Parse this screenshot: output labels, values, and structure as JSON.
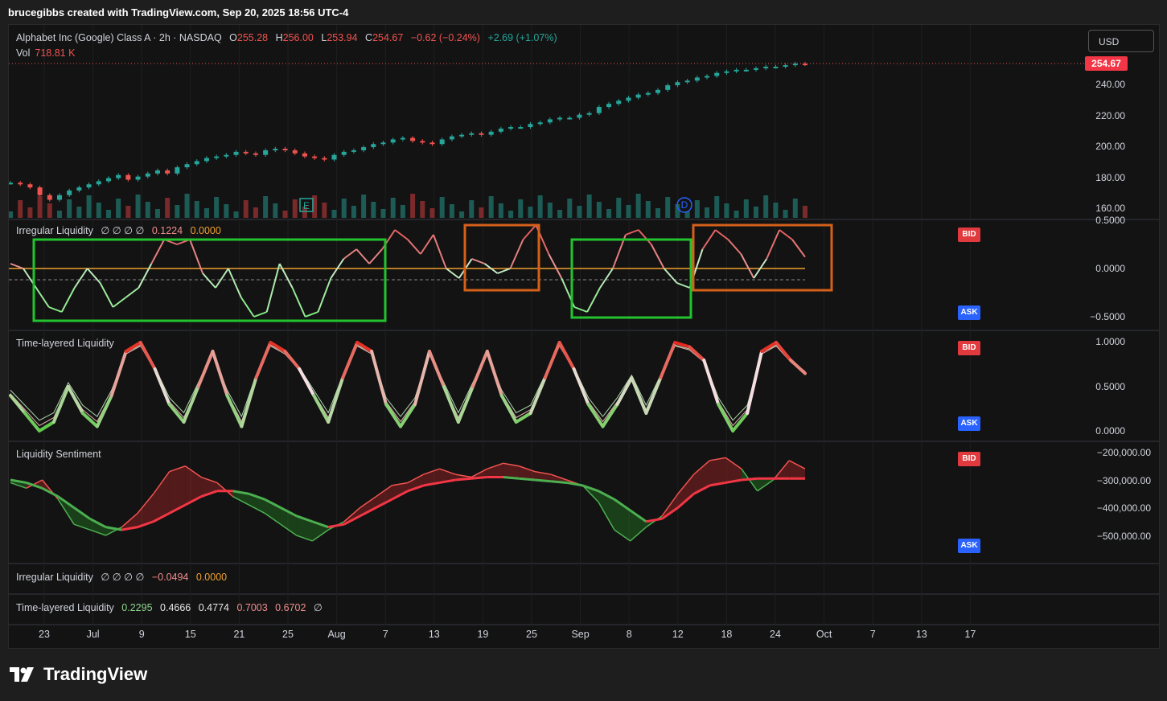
{
  "header": {
    "text": "brucegibbs created with TradingView.com, Sep 20, 2025 18:56 UTC-4"
  },
  "main_pane": {
    "symbol": "Alphabet Inc (Google) Class A · 2h · NASDAQ",
    "o_label": "O",
    "o_value": "255.28",
    "h_label": "H",
    "h_value": "256.00",
    "l_label": "L",
    "l_value": "253.94",
    "c_label": "C",
    "c_value": "254.67",
    "change": "−0.62 (−0.24%)",
    "change2": "+2.69 (+1.07%)",
    "vol_label": "Vol",
    "vol_value": "718.81 K",
    "currency": "USD",
    "last_price": "254.67",
    "y_ticks": [
      "240.00",
      "220.00",
      "200.00",
      "180.00",
      "160.00"
    ],
    "markers": {
      "earnings": "E",
      "dividend": "D"
    }
  },
  "irregular_pane": {
    "title": "Irregular Liquidity",
    "params": "∅ ∅ ∅ ∅",
    "v1": "0.1224",
    "v2": "0.0000",
    "y_ticks": [
      "0.5000",
      "0.0000",
      "−0.5000"
    ],
    "bid": "BID",
    "ask": "ASK"
  },
  "timelayered_pane": {
    "title": "Time-layered Liquidity",
    "y_ticks": [
      "1.0000",
      "0.5000",
      "0.0000"
    ],
    "bid": "BID",
    "ask": "ASK"
  },
  "sentiment_pane": {
    "title": "Liquidity Sentiment",
    "y_ticks": [
      "−200,000.00",
      "−300,000.00",
      "−400,000.00",
      "−500,000.00"
    ],
    "bid": "BID",
    "ask": "ASK"
  },
  "collapsed1": {
    "title": "Irregular Liquidity",
    "params": "∅ ∅ ∅ ∅",
    "v1": "−0.0494",
    "v2": "0.0000"
  },
  "collapsed2": {
    "title": "Time-layered Liquidity",
    "v1": "0.2295",
    "v2": "0.4666",
    "v3": "0.4774",
    "v4": "0.7003",
    "v5": "0.6702",
    "v6": "∅"
  },
  "x_ticks": [
    "23",
    "Jul",
    "9",
    "15",
    "21",
    "25",
    "Aug",
    "7",
    "13",
    "19",
    "25",
    "Sep",
    "8",
    "12",
    "18",
    "24",
    "Oct",
    "7",
    "13",
    "17"
  ],
  "logo": {
    "text": "TradingView"
  },
  "colors": {
    "up": "#26a69a",
    "down": "#ef5350",
    "green_box": "#22c32e",
    "orange_box": "#d4601a",
    "bid": "#e03a3e",
    "ask": "#2962ff"
  },
  "series": {
    "close": [
      178,
      177,
      175,
      170,
      167,
      170,
      173,
      175,
      177,
      179,
      181,
      183,
      180,
      182,
      184,
      186,
      184,
      188,
      190,
      192,
      194,
      195,
      196,
      198,
      197,
      196,
      199,
      200,
      199,
      197,
      195,
      194,
      193,
      196,
      198,
      199,
      201,
      203,
      204,
      206,
      207,
      205,
      204,
      203,
      206,
      208,
      209,
      210,
      209,
      211,
      213,
      214,
      214,
      216,
      217,
      219,
      220,
      220,
      222,
      223,
      227,
      229,
      231,
      233,
      235,
      236,
      238,
      241,
      243,
      244,
      246,
      247,
      249,
      250,
      251,
      251,
      252,
      253,
      253,
      254,
      255,
      254.67
    ],
    "irregular": [
      0.05,
      0.0,
      -0.2,
      -0.4,
      -0.45,
      -0.2,
      0.0,
      -0.15,
      -0.4,
      -0.3,
      -0.2,
      0.05,
      0.3,
      0.25,
      0.3,
      -0.05,
      -0.2,
      0.0,
      -0.3,
      -0.5,
      -0.45,
      0.05,
      -0.2,
      -0.5,
      -0.45,
      -0.1,
      0.1,
      0.2,
      0.05,
      0.2,
      0.4,
      0.3,
      0.15,
      0.35,
      0.0,
      -0.1,
      0.1,
      0.05,
      -0.05,
      0.0,
      0.3,
      0.45,
      0.15,
      -0.1,
      -0.4,
      -0.45,
      -0.2,
      0.0,
      0.35,
      0.4,
      0.25,
      0.0,
      -0.15,
      -0.2,
      0.2,
      0.4,
      0.3,
      0.15,
      -0.1,
      0.1,
      0.4,
      0.3,
      0.12
    ],
    "tl_main": [
      0.4,
      0.2,
      0.0,
      0.1,
      0.5,
      0.2,
      0.05,
      0.4,
      0.9,
      1.0,
      0.7,
      0.3,
      0.1,
      0.5,
      0.9,
      0.4,
      0.05,
      0.6,
      1.0,
      0.9,
      0.7,
      0.4,
      0.1,
      0.6,
      1.0,
      0.9,
      0.3,
      0.05,
      0.3,
      0.9,
      0.5,
      0.1,
      0.5,
      0.9,
      0.4,
      0.1,
      0.2,
      0.6,
      1.0,
      0.7,
      0.3,
      0.05,
      0.3,
      0.6,
      0.2,
      0.6,
      1.0,
      0.95,
      0.8,
      0.3,
      0.0,
      0.2,
      0.9,
      1.0,
      0.8,
      0.65
    ],
    "sentiment": [
      -310,
      -330,
      -300,
      -370,
      -460,
      -480,
      -500,
      -470,
      -420,
      -350,
      -270,
      -250,
      -290,
      -310,
      -360,
      -390,
      -420,
      -460,
      -500,
      -520,
      -480,
      -450,
      -400,
      -360,
      -320,
      -310,
      -280,
      -260,
      -280,
      -290,
      -260,
      -240,
      -250,
      -270,
      -280,
      -300,
      -320,
      -380,
      -480,
      -520,
      -470,
      -430,
      -350,
      -280,
      -230,
      -220,
      -260,
      -340,
      -300,
      -230,
      -260
    ],
    "sentiment_ma": [
      -300,
      -310,
      -330,
      -360,
      -400,
      -440,
      -470,
      -480,
      -470,
      -450,
      -420,
      -390,
      -360,
      -340,
      -340,
      -350,
      -370,
      -400,
      -430,
      -450,
      -470,
      -460,
      -430,
      -400,
      -370,
      -340,
      -320,
      -310,
      -300,
      -295,
      -290,
      -290,
      -295,
      -300,
      -305,
      -310,
      -320,
      -340,
      -370,
      -410,
      -450,
      -440,
      -400,
      -350,
      -320,
      -310,
      -300,
      -295,
      -295,
      -295,
      -295
    ]
  }
}
